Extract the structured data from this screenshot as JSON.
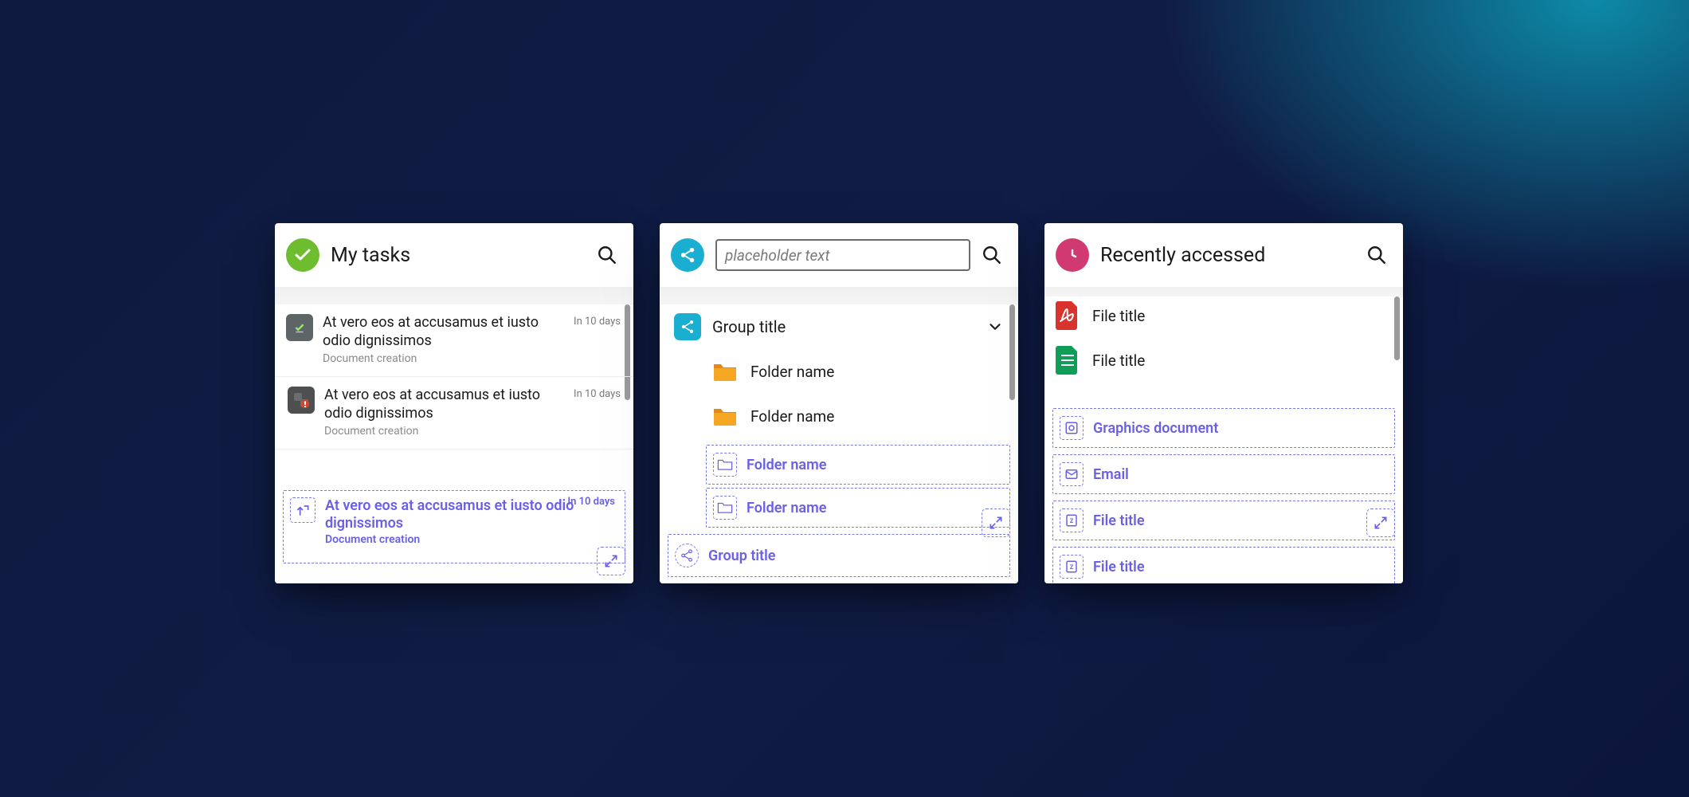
{
  "cards": {
    "tasks": {
      "title": "My tasks",
      "items": [
        {
          "title": "At vero eos at accusamus et iusto odio dignissimos",
          "sub": "Document creation",
          "due": "In 10 days"
        },
        {
          "title": "At vero eos at accusamus et iusto odio dignissimos",
          "sub": "Document creation",
          "due": "In 10 days"
        }
      ],
      "blueprint": {
        "title": "At vero eos at accusamus et iusto odio dignissimos",
        "sub": "Document creation",
        "due": "In 10 days"
      }
    },
    "shared": {
      "search_placeholder": "placeholder text",
      "group_title": "Group title",
      "folders": [
        "Folder name",
        "Folder name",
        "Folder name"
      ],
      "blueprint_group": "Group title"
    },
    "recent": {
      "title": "Recently accessed",
      "files": [
        "File title",
        "File title"
      ],
      "blueprint_files": [
        "Graphics document",
        "Email",
        "File title",
        "File title"
      ]
    }
  }
}
